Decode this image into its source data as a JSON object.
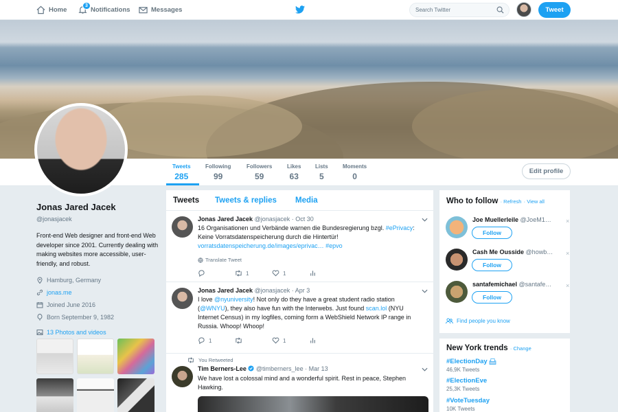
{
  "nav": {
    "home": "Home",
    "notifications": "Notifications",
    "notifications_badge": "3",
    "messages": "Messages",
    "search_placeholder": "Search Twitter",
    "tweet_button": "Tweet"
  },
  "profile": {
    "name": "Jonas Jared Jacek",
    "handle": "@jonasjacek",
    "bio": "Front-end Web designer and front-end Web developer since 2001. Currently dealing with making websites more accessible, user-friendly, and robust.",
    "location": "Hamburg, Germany",
    "website": "jonas.me",
    "joined": "Joined June 2016",
    "born": "Born September 9, 1982",
    "photos": "13 Photos and videos",
    "edit_button": "Edit profile"
  },
  "stats": [
    {
      "label": "Tweets",
      "value": "285"
    },
    {
      "label": "Following",
      "value": "99"
    },
    {
      "label": "Followers",
      "value": "59"
    },
    {
      "label": "Likes",
      "value": "63"
    },
    {
      "label": "Lists",
      "value": "5"
    },
    {
      "label": "Moments",
      "value": "0"
    }
  ],
  "tabs": [
    "Tweets",
    "Tweets & replies",
    "Media"
  ],
  "tweets": [
    {
      "name": "Jonas Jared Jacek",
      "handle": "@jonasjacek",
      "date": "· Oct 30",
      "text_a": "16 Organisationen und Verbände warnen die Bundesregierung bzgl. ",
      "link_a": "#ePrivacy",
      "text_b": ": Keine Vorratsdatenspeicherung durch die Hintertür! ",
      "link_b": "vorratsdatenspeicherung.de/images/eprivac…",
      "text_c": " ",
      "link_c": "#epvo",
      "translate": "Translate Tweet",
      "replies": "",
      "retweets": "1",
      "likes": "1"
    },
    {
      "name": "Jonas Jared Jacek",
      "handle": "@jonasjacek",
      "date": "· Apr 3",
      "text_a": "I love ",
      "link_a": "@nyuniversity",
      "text_b": "! Not only do they have a great student radio station (",
      "link_b": "@WNYU",
      "text_c": "), they also have fun with the Interwebs. Just found ",
      "link_c": "scan.lol",
      "text_d": " (NYU Internet Census) in my logfiles, coming form a WebShield Network IP range in Russia. Whoop! Whoop!",
      "replies": "1",
      "retweets": "",
      "likes": "1"
    },
    {
      "retweeted_label": "You Retweeted",
      "name": "Tim Berners-Lee",
      "handle": "@timberners_lee",
      "date": "· Mar 13",
      "text": "We have lost a colossal mind and a wonderful spirit. Rest in peace, Stephen Hawking."
    }
  ],
  "who_to_follow": {
    "title": "Who to follow",
    "refresh": "· Refresh",
    "view_all": "· View all",
    "follow_label": "Follow",
    "users": [
      {
        "name": "Joe Muellerleile",
        "handle": "@JoeM1…"
      },
      {
        "name": "Cash Me Ousside",
        "handle": "@howb…"
      },
      {
        "name": "santafemichael",
        "handle": "@santafe…"
      }
    ],
    "find_people": "Find people you know"
  },
  "trends": {
    "title": "New York trends",
    "change": "· Change",
    "items": [
      {
        "name": "#ElectionDay",
        "count": "46,9K Tweets"
      },
      {
        "name": "#ElectionEve",
        "count": "25,3K Tweets"
      },
      {
        "name": "#VoteTuesday",
        "count": "10K Tweets"
      }
    ]
  },
  "colors": {
    "accent": "#1da1f2",
    "muted": "#657786",
    "bg": "#e6ecf0"
  }
}
